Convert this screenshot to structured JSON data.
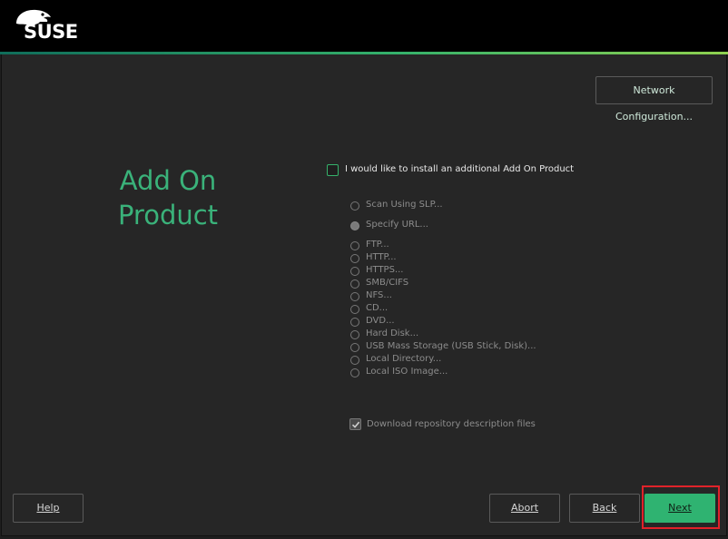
{
  "brand": {
    "logo_text": "SUSE",
    "accent": "#35b26b"
  },
  "header": {
    "network_button": "Network Configuration..."
  },
  "page": {
    "title_line1": "Add On",
    "title_line2": "Product"
  },
  "addon_checkbox": {
    "label": "I would like to install an additional Add On Product",
    "checked": false
  },
  "sources": [
    {
      "label": "Scan Using SLP...",
      "selected": false
    },
    {
      "label": "Specify URL...",
      "selected": true
    },
    {
      "label": "FTP...",
      "selected": false
    },
    {
      "label": "HTTP...",
      "selected": false
    },
    {
      "label": "HTTPS...",
      "selected": false
    },
    {
      "label": "SMB/CIFS",
      "selected": false
    },
    {
      "label": "NFS...",
      "selected": false
    },
    {
      "label": "CD...",
      "selected": false
    },
    {
      "label": "DVD...",
      "selected": false
    },
    {
      "label": "Hard Disk...",
      "selected": false
    },
    {
      "label": "USB Mass Storage (USB Stick, Disk)...",
      "selected": false
    },
    {
      "label": "Local Directory...",
      "selected": false
    },
    {
      "label": "Local ISO Image...",
      "selected": false
    }
  ],
  "download_checkbox": {
    "label": "Download repository description files",
    "checked": true
  },
  "footer": {
    "help": "Help",
    "abort": "Abort",
    "back": "Back",
    "next": "Next"
  }
}
